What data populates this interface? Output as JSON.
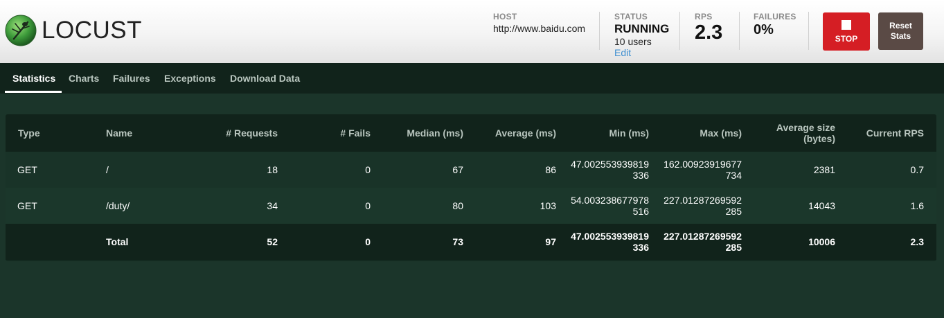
{
  "app": {
    "logo_text": "LOCUST"
  },
  "header": {
    "host": {
      "label": "HOST",
      "value": "http://www.baidu.com"
    },
    "status": {
      "label": "STATUS",
      "value": "RUNNING",
      "users": "10 users",
      "edit": "Edit"
    },
    "rps": {
      "label": "RPS",
      "value": "2.3"
    },
    "failures": {
      "label": "FAILURES",
      "value": "0%"
    },
    "stop_label": "STOP",
    "reset_label_line1": "Reset",
    "reset_label_line2": "Stats"
  },
  "tabs": [
    {
      "label": "Statistics",
      "active": true
    },
    {
      "label": "Charts",
      "active": false
    },
    {
      "label": "Failures",
      "active": false
    },
    {
      "label": "Exceptions",
      "active": false
    },
    {
      "label": "Download Data",
      "active": false
    }
  ],
  "table": {
    "headers": [
      "Type",
      "Name",
      "# Requests",
      "# Fails",
      "Median (ms)",
      "Average (ms)",
      "Min (ms)",
      "Max (ms)",
      "Average size",
      "(bytes)",
      "Current RPS"
    ],
    "rows": [
      {
        "type": "GET",
        "name": "/",
        "requests": "18",
        "fails": "0",
        "median": "67",
        "average": "86",
        "min_1": "47.002553939819",
        "min_2": "336",
        "max_1": "162.00923919677",
        "max_2": "734",
        "avg_size": "2381",
        "rps": "0.7"
      },
      {
        "type": "GET",
        "name": "/duty/",
        "requests": "34",
        "fails": "0",
        "median": "80",
        "average": "103",
        "min_1": "54.003238677978",
        "min_2": "516",
        "max_1": "227.01287269592",
        "max_2": "285",
        "avg_size": "14043",
        "rps": "1.6"
      }
    ],
    "total": {
      "name": "Total",
      "requests": "52",
      "fails": "0",
      "median": "73",
      "average": "97",
      "min_1": "47.002553939819",
      "min_2": "336",
      "max_1": "227.01287269592",
      "max_2": "285",
      "avg_size": "10006",
      "rps": "2.3"
    }
  },
  "colors": {
    "stop": "#d51e24",
    "reset": "#5a4a45",
    "background": "#1b352a",
    "link": "#3f8fd0"
  }
}
